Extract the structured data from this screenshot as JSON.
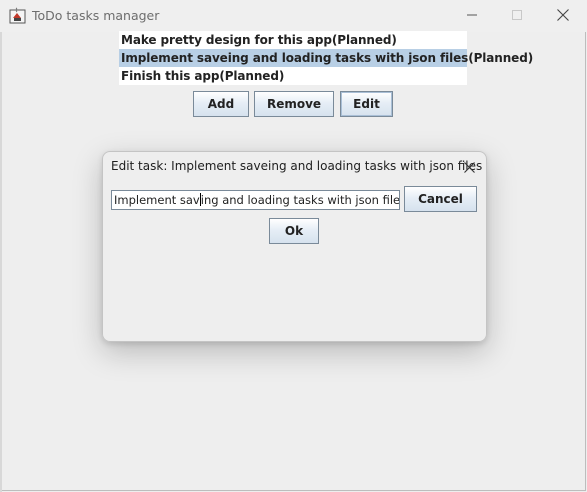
{
  "window": {
    "title": "ToDo tasks manager"
  },
  "tasks": [
    {
      "label": "Make pretty design for this app(Planned)",
      "selected": false
    },
    {
      "label": "Implement saveing and loading tasks with json files(Planned)",
      "selected": true
    },
    {
      "label": "Finish this app(Planned)",
      "selected": false
    }
  ],
  "toolbar": {
    "add_label": "Add",
    "remove_label": "Remove",
    "edit_label": "Edit"
  },
  "dialog": {
    "title": "Edit task: Implement saveing and loading tasks with json files",
    "field_before_caret": "Implement sav",
    "field_after_caret": "ing and loading tasks with json files",
    "cancel_label": "Cancel",
    "ok_label": "Ok"
  },
  "colors": {
    "selection": "#b8cfe5",
    "window_bg": "#eeeeee",
    "button_border": "#7a8a99"
  }
}
